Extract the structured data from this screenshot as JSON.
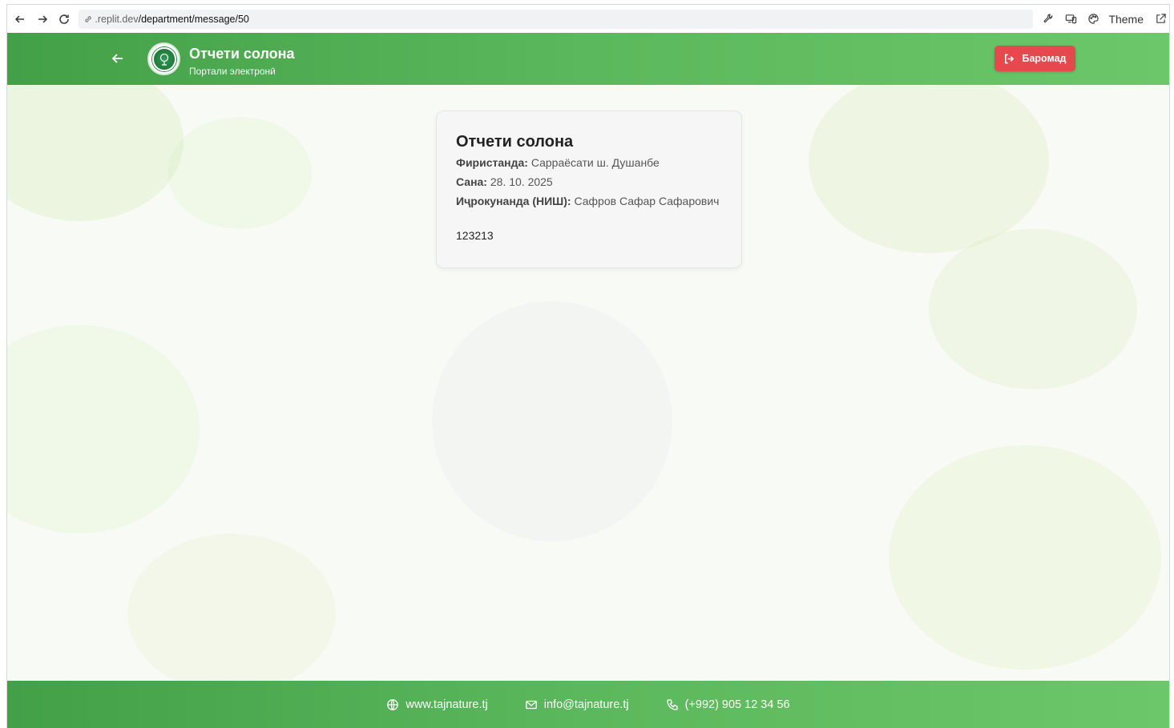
{
  "browser": {
    "url_host": ".replit.dev",
    "url_path": "/department/message/50",
    "theme_label": "Theme"
  },
  "header": {
    "title": "Отчети солона",
    "subtitle": "Портали электронӣ",
    "logout_label": "Баромад"
  },
  "report": {
    "title": "Отчети солона",
    "sender_label": "Фиристанда:",
    "sender_value": "Сарраёсати ш. Душанбе",
    "date_label": "Сана:",
    "date_value": "28. 10. 2025",
    "executor_label": "Иҷрокунанда (НИШ):",
    "executor_value": "Сафров Сафар Сафарович",
    "body": "123213"
  },
  "footer": {
    "website": "www.tajnature.tj",
    "email": "info@tajnature.tj",
    "phone": "(+992) 905 12 34 56"
  },
  "colors": {
    "header_green": "#43a047",
    "logout_red": "#e5484d"
  }
}
